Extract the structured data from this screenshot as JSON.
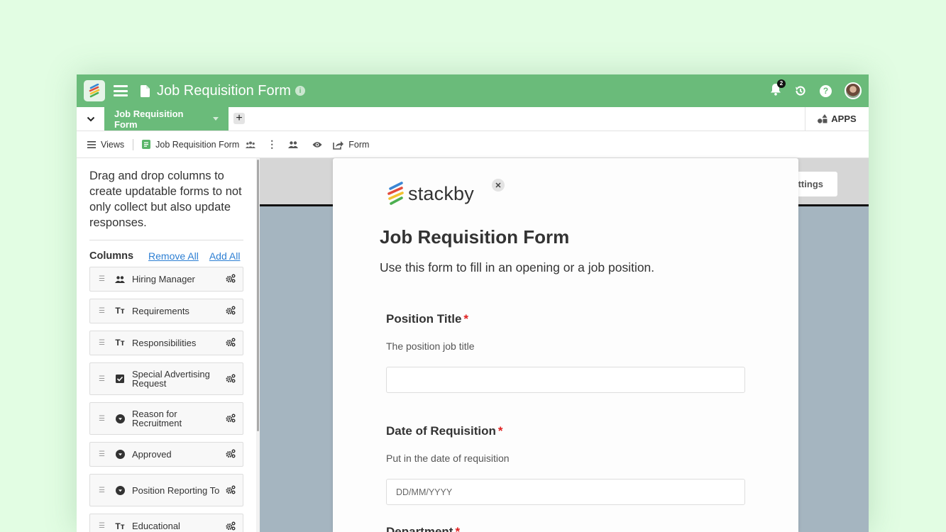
{
  "header": {
    "app_title": "Job Requisition Form",
    "notification_count": "2",
    "brand_color": "#6abb7a"
  },
  "tabs": {
    "active_tab": "Job Requisition Form",
    "add_tab_label": "+",
    "apps_label": "APPS"
  },
  "viewbar": {
    "views_label": "Views",
    "current_view": "Job Requisition Form",
    "form_label": "Form"
  },
  "sidebar": {
    "description": "Drag and drop columns to create updatable forms to not only collect but also update responses.",
    "columns_title": "Columns",
    "remove_all": "Remove All",
    "add_all": "Add All",
    "columns": [
      {
        "label": "Hiring Manager",
        "type_icon": "people-icon"
      },
      {
        "label": "Requirements",
        "type_icon": "text-icon"
      },
      {
        "label": "Responsibilities",
        "type_icon": "text-icon"
      },
      {
        "label": "Special Advertising Request",
        "type_icon": "checkbox-icon"
      },
      {
        "label": "Reason for Recruitment",
        "type_icon": "dropdown-icon"
      },
      {
        "label": "Approved",
        "type_icon": "dropdown-icon"
      },
      {
        "label": "Position Reporting To",
        "type_icon": "dropdown-icon"
      },
      {
        "label": "Educational",
        "type_icon": "text-icon"
      }
    ]
  },
  "main": {
    "settings_label": "ettings"
  },
  "form": {
    "brand_name": "stackby",
    "title": "Job Requisition Form",
    "description": "Use this form to fill in an opening or a job position.",
    "fields": [
      {
        "label": "Position Title",
        "required": "*",
        "help": "The position job title",
        "placeholder": "",
        "value": ""
      },
      {
        "label": "Date of Requisition",
        "required": "*",
        "help": "Put in the date of requisition",
        "placeholder": "DD/MM/YYYY",
        "value": ""
      }
    ],
    "next_field_label": "Department",
    "next_field_required": "*"
  }
}
